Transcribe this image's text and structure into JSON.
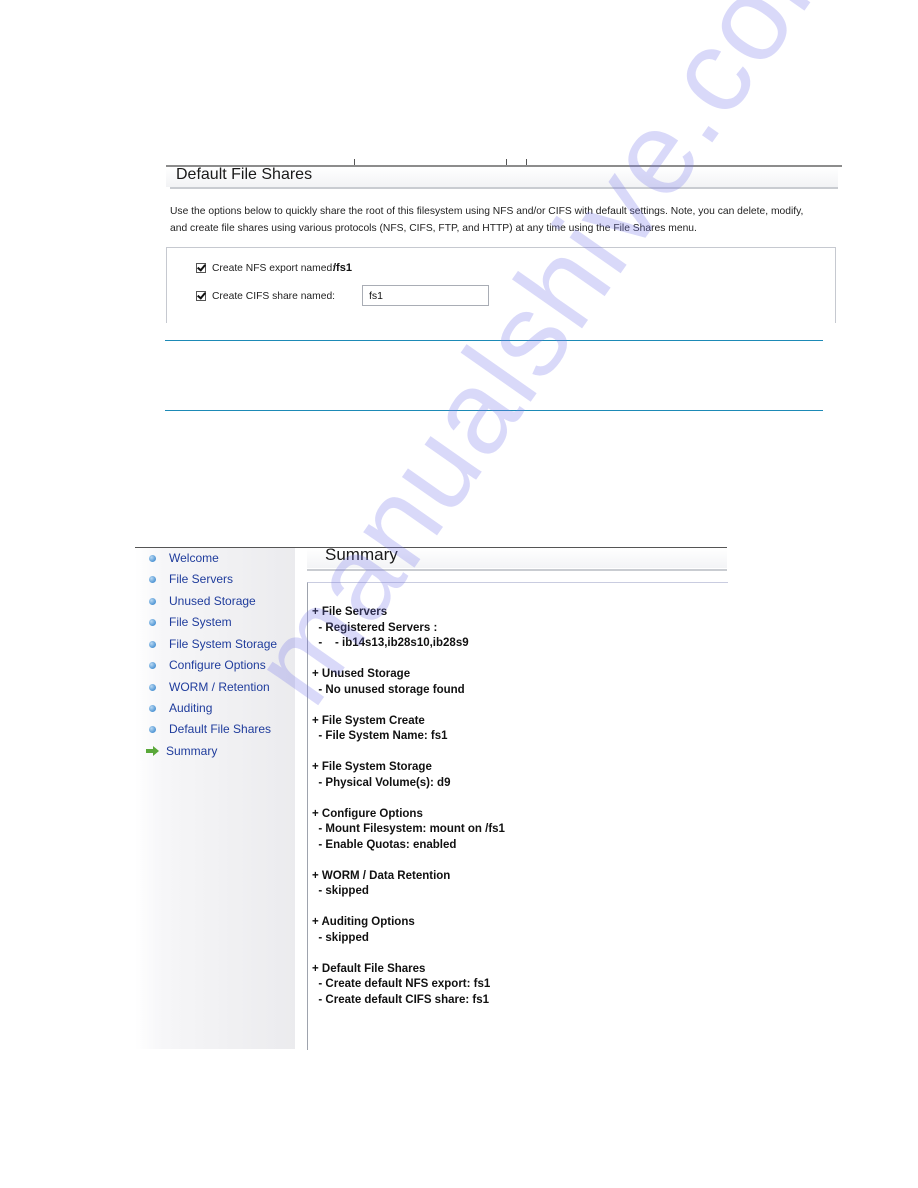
{
  "default_file_shares_panel": {
    "title": "Default File Shares",
    "description_line1": "Use the options below to quickly share the root of this filesystem using NFS and/or CIFS with default settings. Note, you can delete, modify,",
    "description_line2": "and create file shares using various protocols (NFS, CIFS, FTP, and HTTP) at any time using the File Shares menu.",
    "nfs_option": {
      "label": "Create NFS export named:",
      "checked": true,
      "value": "/fs1"
    },
    "cifs_option": {
      "label": "Create CIFS share named:",
      "checked": true,
      "value": "fs1"
    }
  },
  "wizard": {
    "nav": [
      {
        "label": "Welcome",
        "icon": "bullet-icon",
        "current": false
      },
      {
        "label": "File Servers",
        "icon": "bullet-icon",
        "current": false
      },
      {
        "label": "Unused Storage",
        "icon": "bullet-icon",
        "current": false
      },
      {
        "label": "File System",
        "icon": "bullet-icon",
        "current": false
      },
      {
        "label": "File System Storage",
        "icon": "bullet-icon",
        "current": false
      },
      {
        "label": "Configure Options",
        "icon": "bullet-icon",
        "current": false
      },
      {
        "label": "WORM / Retention",
        "icon": "bullet-icon",
        "current": false
      },
      {
        "label": "Auditing",
        "icon": "bullet-icon",
        "current": false
      },
      {
        "label": "Default File Shares",
        "icon": "bullet-icon",
        "current": false
      },
      {
        "label": "Summary",
        "icon": "green-arrow-icon",
        "current": true
      }
    ],
    "summary": {
      "title": "Summary",
      "sections": [
        {
          "heading": "+ File Servers",
          "lines": [
            "  - Registered Servers :",
            "  -    - ib14s13,ib28s10,ib28s9"
          ]
        },
        {
          "heading": "+ Unused Storage",
          "lines": [
            "  - No unused storage found"
          ]
        },
        {
          "heading": "+ File System Create",
          "lines": [
            "  - File System Name: fs1"
          ]
        },
        {
          "heading": "+ File System Storage",
          "lines": [
            "  - Physical Volume(s): d9"
          ]
        },
        {
          "heading": "+ Configure Options",
          "lines": [
            "  - Mount Filesystem: mount on /fs1",
            "  - Enable Quotas: enabled"
          ]
        },
        {
          "heading": "+ WORM / Data Retention",
          "lines": [
            "  - skipped"
          ]
        },
        {
          "heading": "+ Auditing Options",
          "lines": [
            "  - skipped"
          ]
        },
        {
          "heading": "+ Default File Shares",
          "lines": [
            "  - Create default NFS export: fs1",
            "  - Create default CIFS share: fs1"
          ]
        }
      ]
    }
  },
  "watermark": {
    "text": "manualshive.com"
  },
  "colors": {
    "link_blue": "#1f3c9c",
    "rule_blue": "#1d8ab6",
    "current_arrow_green": "#5aa83a"
  }
}
